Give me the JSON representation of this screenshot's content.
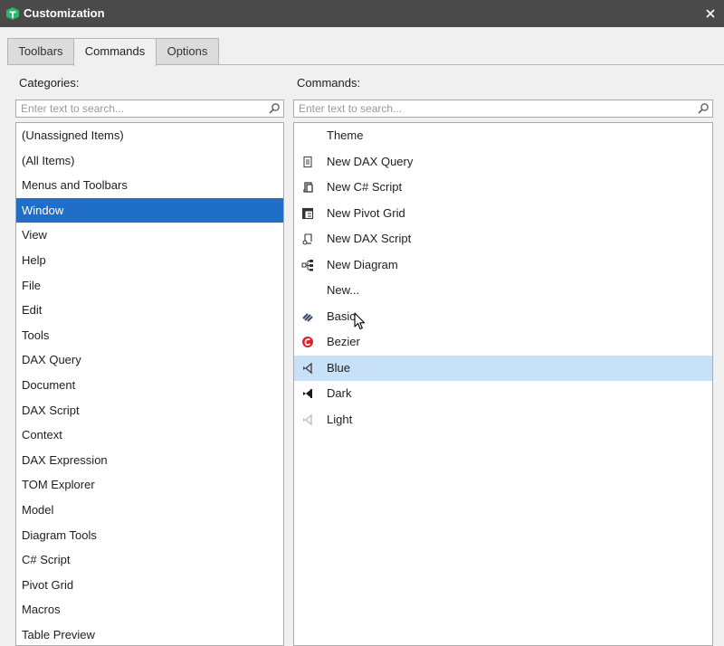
{
  "window": {
    "title": "Customization"
  },
  "tabs": [
    {
      "label": "Toolbars"
    },
    {
      "label": "Commands"
    },
    {
      "label": "Options"
    }
  ],
  "categories": {
    "label": "Categories:",
    "placeholder": "Enter text to search...",
    "selected": "Window",
    "items": [
      "(Unassigned Items)",
      "(All Items)",
      "Menus and Toolbars",
      "Window",
      "View",
      "Help",
      "File",
      "Edit",
      "Tools",
      "DAX Query",
      "Document",
      "DAX Script",
      "Context",
      "DAX Expression",
      "TOM Explorer",
      "Model",
      "Diagram Tools",
      "C# Script",
      "Pivot Grid",
      "Macros",
      "Table Preview"
    ]
  },
  "commands": {
    "label": "Commands:",
    "placeholder": "Enter text to search...",
    "highlighted": "Blue",
    "items": [
      {
        "label": "Theme",
        "icon": "none"
      },
      {
        "label": "New DAX Query",
        "icon": "document-icon"
      },
      {
        "label": "New C# Script",
        "icon": "script-icon"
      },
      {
        "label": "New Pivot Grid",
        "icon": "pivot-grid-icon"
      },
      {
        "label": "New DAX Script",
        "icon": "dax-script-icon"
      },
      {
        "label": "New Diagram",
        "icon": "diagram-icon"
      },
      {
        "label": "New...",
        "icon": "none"
      },
      {
        "label": "Basic",
        "icon": "basic-theme-icon"
      },
      {
        "label": "Bezier",
        "icon": "bezier-theme-icon"
      },
      {
        "label": "Blue",
        "icon": "vs-blue-icon"
      },
      {
        "label": "Dark",
        "icon": "vs-dark-icon"
      },
      {
        "label": "Light",
        "icon": "vs-light-icon"
      }
    ]
  },
  "colors": {
    "titlebar": "#4a4a4a",
    "app_icon": "#2bb673",
    "selection": "#1f6fc9",
    "highlight": "#c7e1f8",
    "bezier_red": "#d9232e"
  }
}
